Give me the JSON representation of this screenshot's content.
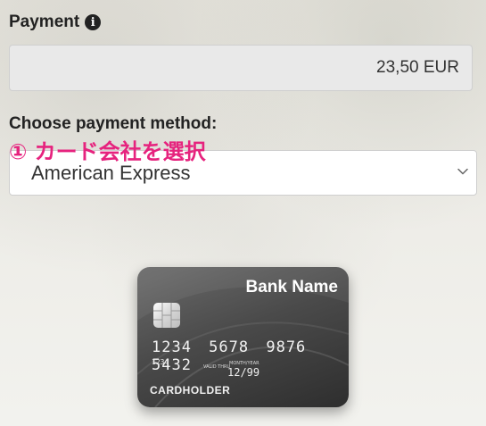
{
  "payment": {
    "label": "Payment",
    "info_icon": "info-circle-icon",
    "amount": "23,50 EUR"
  },
  "method": {
    "label": "Choose payment method:",
    "annotation": "① カード会社を選択",
    "selected": "American Express",
    "dropdown_icon": "chevron-down-icon"
  },
  "card": {
    "bank_name": "Bank Name",
    "number": "1234 5678 9876 5432",
    "small_number": "1234",
    "valid_thru": "VALID THRU",
    "month_year_label": "MONTH/YEAR",
    "expiry": "12/99",
    "cardholder": "CARDHOLDER"
  },
  "colors": {
    "annotation": "#e6237e",
    "card_dark": "#2e2e2e"
  }
}
